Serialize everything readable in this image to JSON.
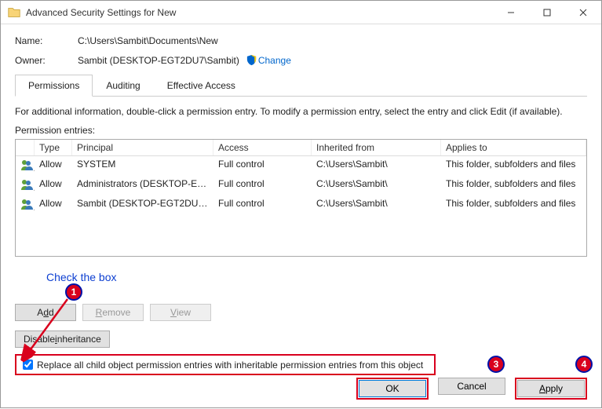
{
  "window": {
    "title": "Advanced Security Settings for New"
  },
  "fields": {
    "name_label": "Name:",
    "name_value": "C:\\Users\\Sambit\\Documents\\New",
    "owner_label": "Owner:",
    "owner_value": "Sambit (DESKTOP-EGT2DU7\\Sambit)",
    "change_link": "Change"
  },
  "tabs": {
    "permissions": "Permissions",
    "auditing": "Auditing",
    "effective": "Effective Access"
  },
  "info_text": "For additional information, double-click a permission entry. To modify a permission entry, select the entry and click Edit (if available).",
  "entries_label": "Permission entries:",
  "columns": {
    "type": "Type",
    "principal": "Principal",
    "access": "Access",
    "inherited": "Inherited from",
    "applies": "Applies to"
  },
  "rows": [
    {
      "type": "Allow",
      "principal": "SYSTEM",
      "access": "Full control",
      "inherited": "C:\\Users\\Sambit\\",
      "applies": "This folder, subfolders and files"
    },
    {
      "type": "Allow",
      "principal": "Administrators (DESKTOP-EG...",
      "access": "Full control",
      "inherited": "C:\\Users\\Sambit\\",
      "applies": "This folder, subfolders and files"
    },
    {
      "type": "Allow",
      "principal": "Sambit (DESKTOP-EGT2DU7\\S...",
      "access": "Full control",
      "inherited": "C:\\Users\\Sambit\\",
      "applies": "This folder, subfolders and files"
    }
  ],
  "hint": "Check the box",
  "buttons": {
    "add": "Add",
    "remove": "Remove",
    "view": "View",
    "disable_inh": "Disable inheritance",
    "ok": "OK",
    "cancel": "Cancel",
    "apply": "Apply"
  },
  "checkbox_label": "Replace all child object permission entries with inheritable permission entries from this object",
  "annotations": {
    "a1": "1",
    "a3": "3",
    "a4": "4"
  }
}
